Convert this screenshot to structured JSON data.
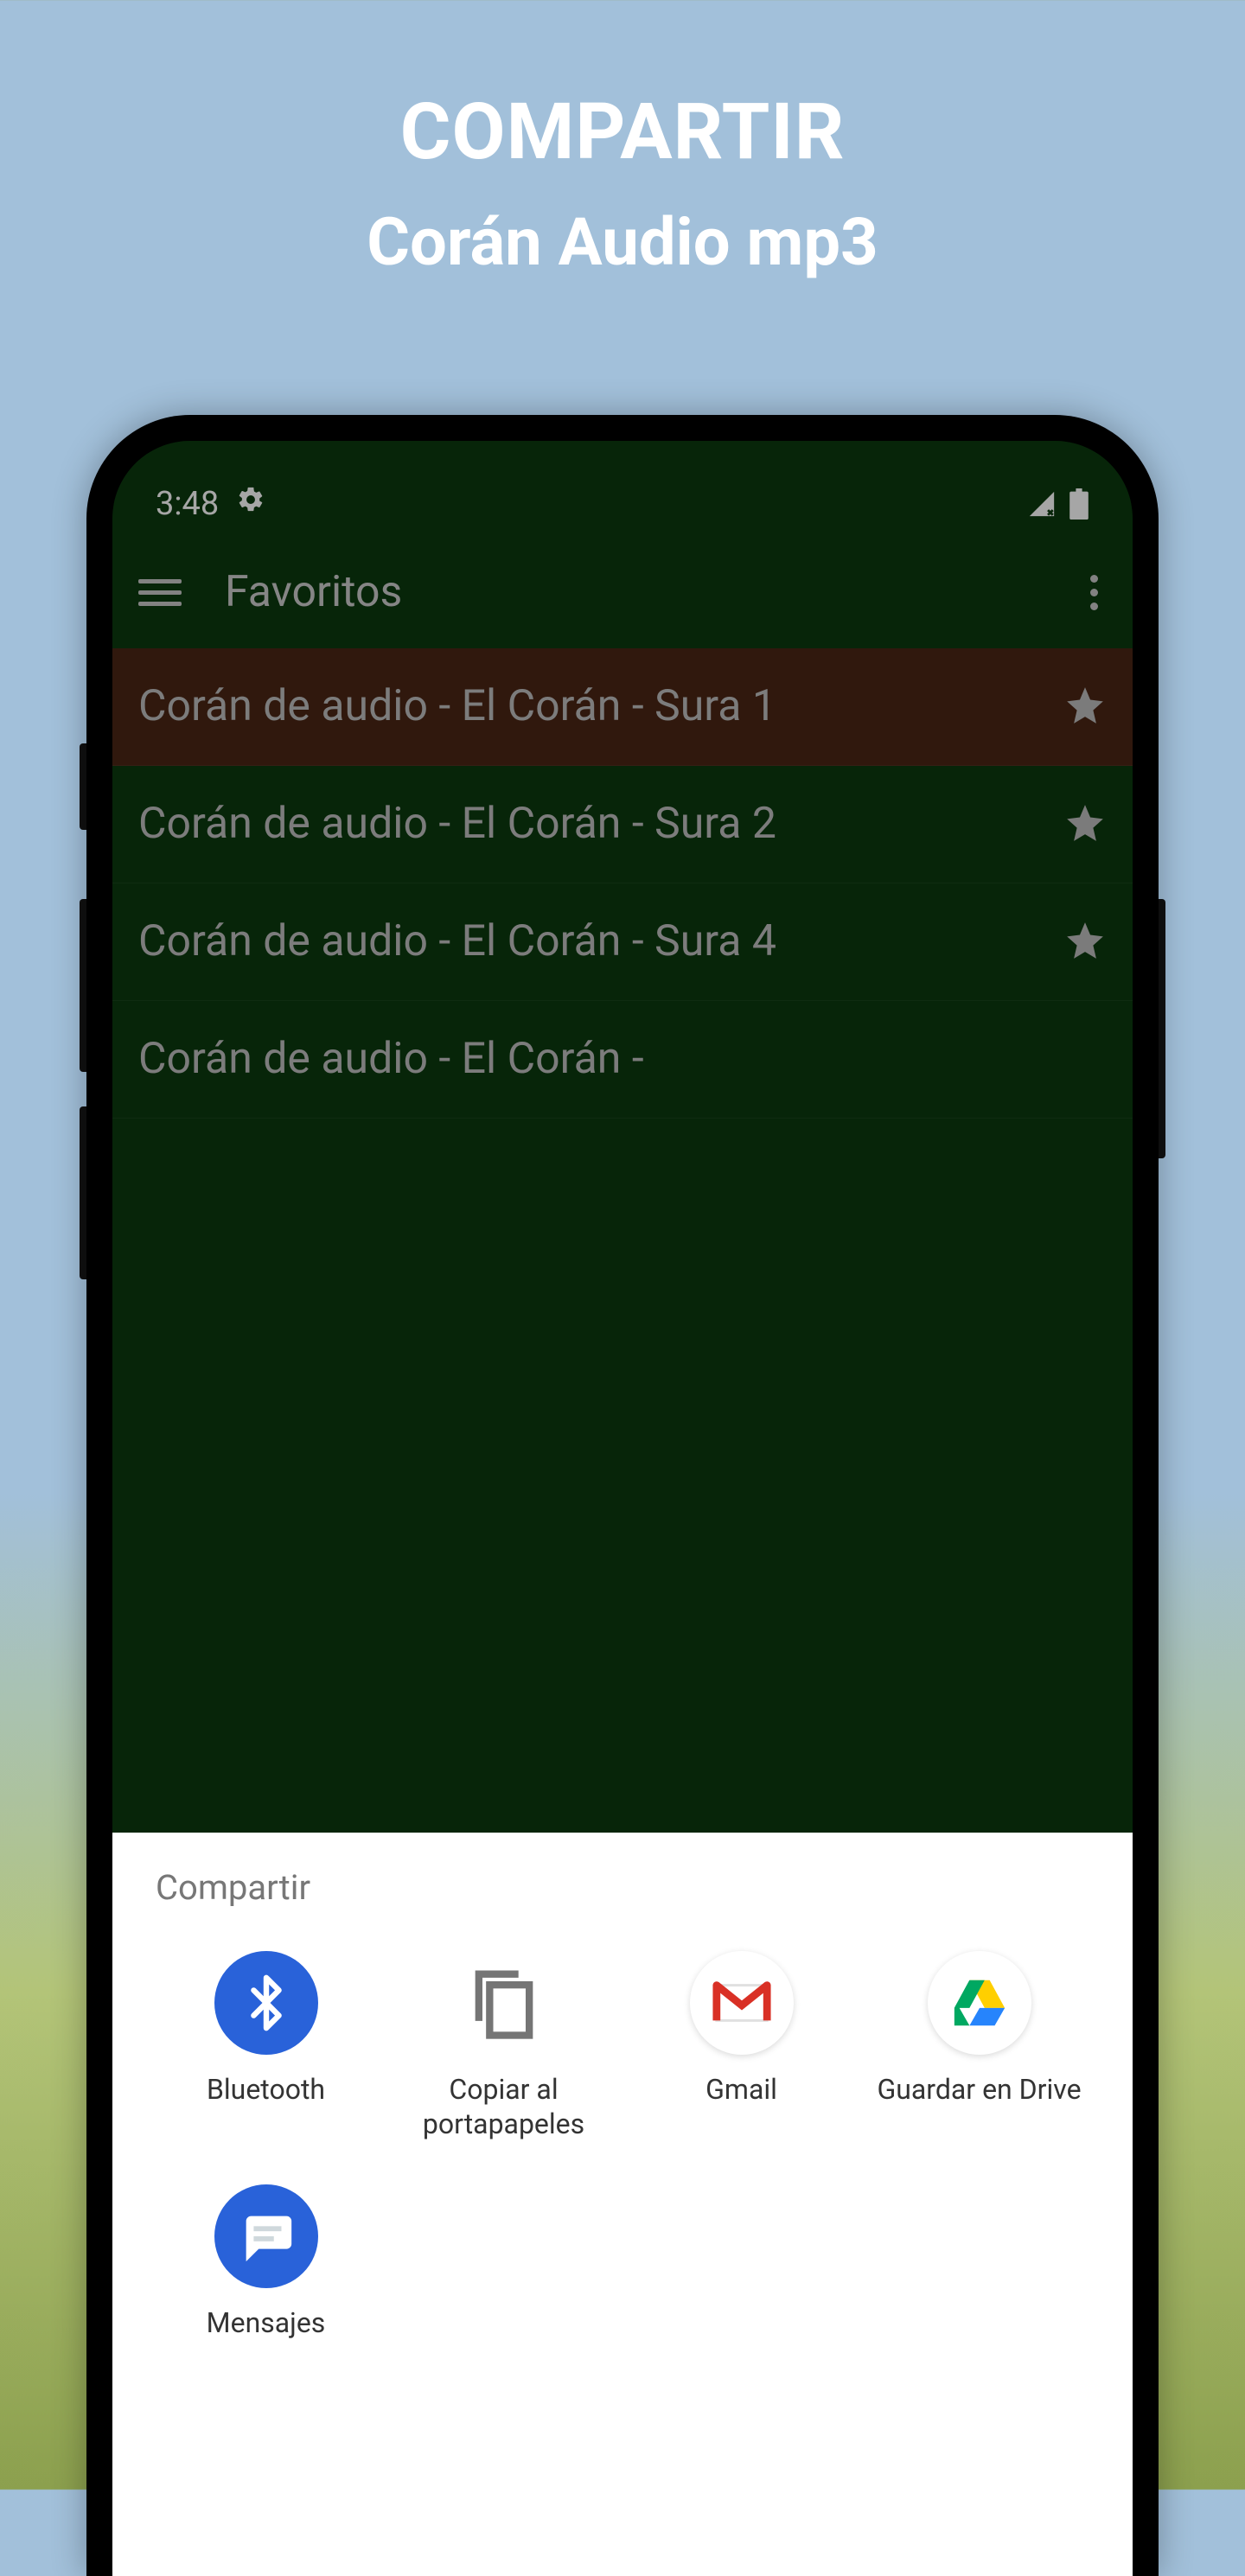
{
  "promo": {
    "title": "COMPARTIR",
    "subtitle": "Corán Audio mp3"
  },
  "status": {
    "time": "3:48",
    "icons": {
      "settings": "gear-icon",
      "signal": "signal-icon",
      "battery": "battery-icon"
    }
  },
  "appbar": {
    "title": "Favoritos",
    "menu_icon": "hamburger-icon",
    "more_icon": "more-vertical-icon"
  },
  "list": {
    "items": [
      {
        "label": "Corán de audio - El Corán - Sura 1",
        "favorite": true,
        "active": true
      },
      {
        "label": "Corán de audio - El Corán - Sura 2",
        "favorite": true,
        "active": false
      },
      {
        "label": "Corán de audio - El Corán - Sura 4",
        "favorite": true,
        "active": false
      },
      {
        "label": "Corán de audio - El Corán -",
        "favorite": true,
        "active": false
      }
    ]
  },
  "share": {
    "title": "Compartir",
    "targets": [
      {
        "label": "Bluetooth",
        "icon": "bluetooth-icon"
      },
      {
        "label": "Copiar al portapapeles",
        "icon": "copy-icon"
      },
      {
        "label": "Gmail",
        "icon": "gmail-icon"
      },
      {
        "label": "Guardar en Drive",
        "icon": "drive-icon"
      },
      {
        "label": "Mensajes",
        "icon": "messages-icon"
      }
    ]
  },
  "colors": {
    "app_green": "#0b3a0f",
    "active_row": "#4a2514",
    "bluetooth_blue": "#2962d9"
  }
}
